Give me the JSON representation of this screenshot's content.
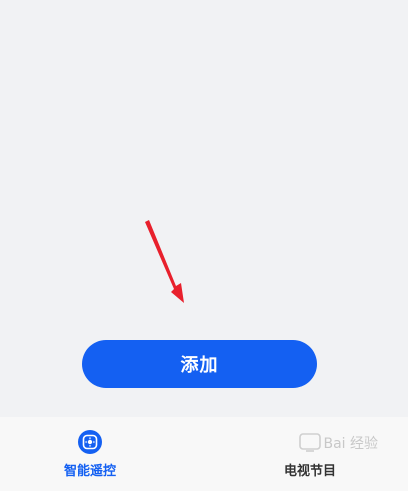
{
  "main": {
    "add_button_label": "添加"
  },
  "bottom_nav": {
    "items": [
      {
        "label": "智能遥控",
        "icon": "remote-control-icon",
        "active": true
      },
      {
        "label": "电视节目",
        "icon": "tv-icon",
        "active": false
      }
    ]
  },
  "watermark": {
    "text": "Bai 经验"
  },
  "colors": {
    "accent": "#1460f2",
    "background": "#f1f2f4",
    "nav_background": "#f8f8f8",
    "annotation_arrow": "#e8202c"
  }
}
